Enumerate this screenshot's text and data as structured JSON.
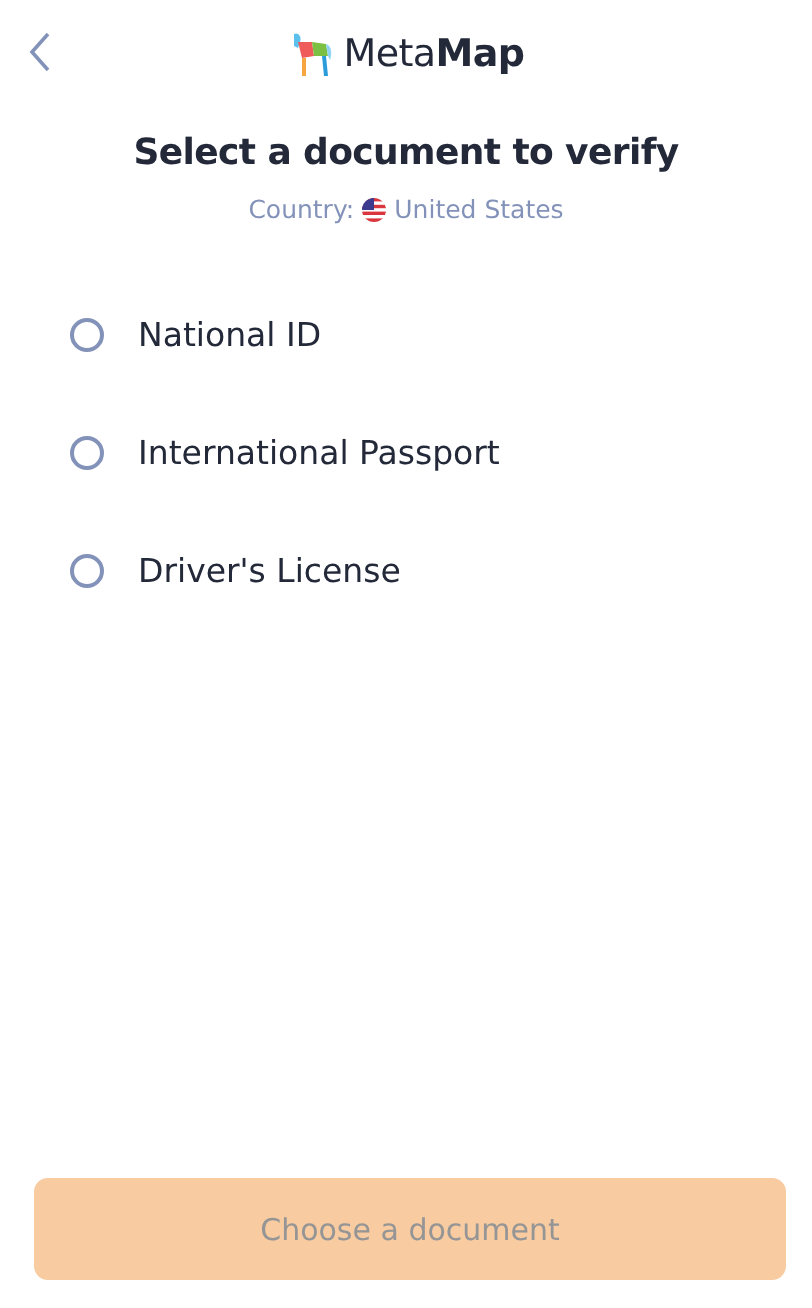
{
  "header": {
    "logo_text": "Meta**Map**"
  },
  "title": "Select a document to verify",
  "country": {
    "label": "Country:",
    "name": "United States"
  },
  "documents": [
    {
      "label": "National ID",
      "selected": false
    },
    {
      "label": "International Passport",
      "selected": false
    },
    {
      "label": "Driver's License",
      "selected": false
    }
  ],
  "submit": {
    "label": "Choose a document",
    "disabled": true
  }
}
